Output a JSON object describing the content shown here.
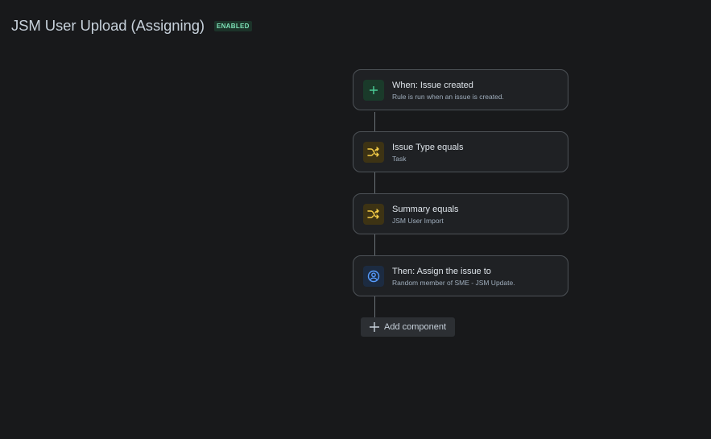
{
  "header": {
    "title": "JSM User Upload (Assigning)",
    "status_badge": "ENABLED"
  },
  "rule_steps": [
    {
      "kind": "trigger",
      "icon": "plus-icon",
      "title": "When: Issue created",
      "subtitle": "Rule is run when an issue is created."
    },
    {
      "kind": "condition",
      "icon": "shuffle-icon",
      "title": "Issue Type equals",
      "subtitle": "Task"
    },
    {
      "kind": "condition",
      "icon": "shuffle-icon",
      "title": "Summary equals",
      "subtitle": "JSM User Import"
    },
    {
      "kind": "action",
      "icon": "user-circle-icon",
      "title": "Then: Assign the issue to",
      "subtitle": "Random member of SME - JSM Update."
    }
  ],
  "add_component": {
    "label": "Add component"
  },
  "colors": {
    "background": "#18191b",
    "card_background": "#1f2124",
    "card_border": "#4d5257",
    "trigger_accent": "#4bce97",
    "condition_accent": "#f5cd47",
    "action_accent": "#579dff",
    "badge_text": "#7ee2b8"
  }
}
